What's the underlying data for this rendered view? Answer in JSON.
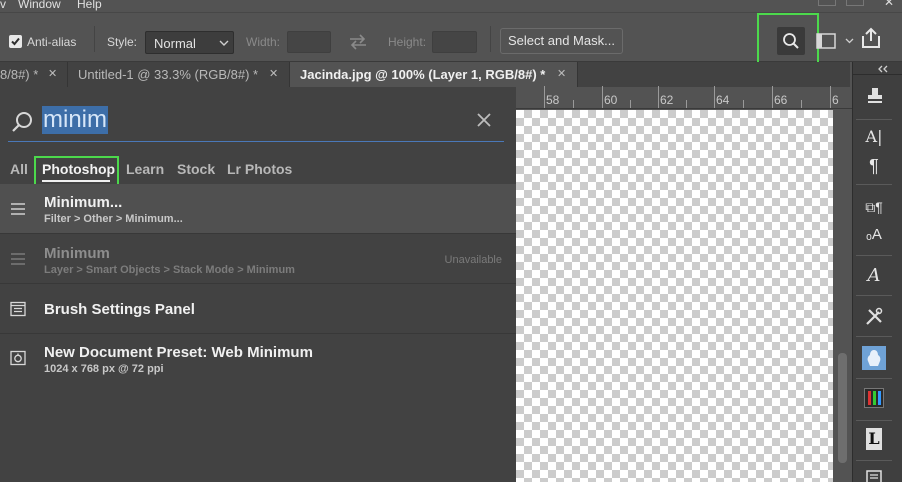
{
  "menubar": {
    "items": [
      "v",
      "Window",
      "Help"
    ]
  },
  "options": {
    "anti_alias_label": "Anti-alias",
    "anti_alias_checked": true,
    "style_label": "Style:",
    "style_value": "Normal",
    "width_label": "Width:",
    "height_label": "Height:",
    "select_mask_label": "Select and Mask..."
  },
  "tabs": [
    {
      "label": "8/8#) *",
      "active": false
    },
    {
      "label": "Untitled-1 @ 33.3% (RGB/8#) *",
      "active": false
    },
    {
      "label": "Jacinda.jpg @ 100% (Layer 1, RGB/8#) *",
      "active": true
    }
  ],
  "ruler": {
    "numbers": [
      "58",
      "60",
      "62",
      "64",
      "66",
      "6"
    ]
  },
  "search": {
    "query": "minim",
    "filter_tabs": [
      "All",
      "Photoshop",
      "Learn",
      "Stock",
      "Lr Photos"
    ],
    "active_filter": "Photoshop",
    "results": [
      {
        "title": "Minimum...",
        "path": "Filter > Other > Minimum...",
        "icon": "menu-lines-icon",
        "available": true
      },
      {
        "title": "Minimum",
        "path": "Layer > Smart Objects > Stack Mode > Minimum",
        "icon": "menu-lines-icon",
        "available": false,
        "status": "Unavailable"
      },
      {
        "title": "Brush Settings Panel",
        "path": "",
        "icon": "panel-list-icon",
        "available": true
      },
      {
        "title": "New Document Preset: Web Minimum",
        "path": "1024 x 768 px @ 72 ppi",
        "icon": "document-preset-icon",
        "available": true
      }
    ]
  },
  "colors": {
    "highlight": "#4cd94c",
    "query_selection": "#3d6ea8",
    "panel_bg": "#424242",
    "app_bg": "#535353"
  },
  "dock_icons": [
    "collapse-icon",
    "stamp-icon",
    "character-icon",
    "paragraph-icon",
    "paragraph-styles-icon",
    "character-styles-icon",
    "glyphs-icon",
    "tools-icon",
    "libraries-icon",
    "channels-icon",
    "learn-icon",
    "panel-icon"
  ]
}
